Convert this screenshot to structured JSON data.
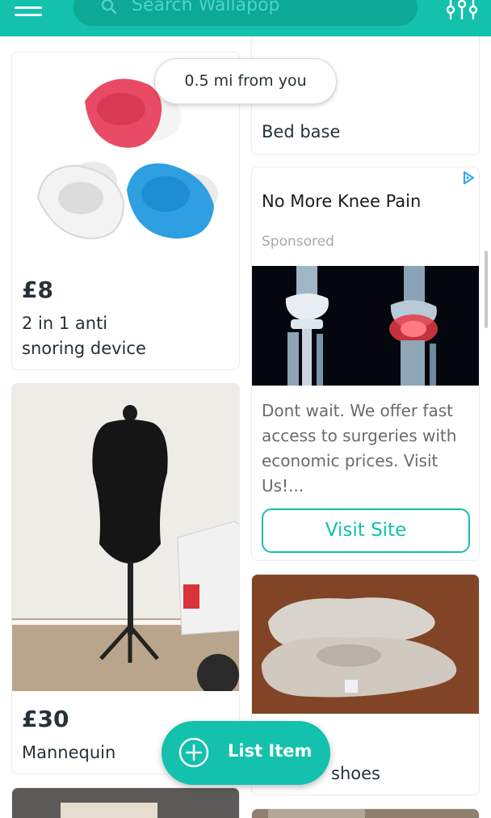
{
  "header": {
    "search_placeholder": "Search Wallapop",
    "menu_icon": "hamburger-menu-icon",
    "search_icon": "search-icon",
    "filter_icon": "sliders-filter-icon"
  },
  "distance_pill": {
    "label": "0.5 mi from you"
  },
  "listings": [
    {
      "price": "£8",
      "title_lines": [
        "2 in 1 anti",
        "snoring device"
      ]
    },
    {
      "price": "£30",
      "title": "Mannequin"
    },
    {
      "title": "Bed base"
    },
    {
      "title": "shoes"
    }
  ],
  "ad": {
    "title": "No More Knee Pain",
    "sponsored_label": "Sponsored",
    "description_lines": [
      "Dont wait. We offer fast",
      "access to surgeries with",
      "economic prices. Visit",
      "Us!..."
    ],
    "cta": "Visit Site",
    "badge_icon": "adchoices-icon"
  },
  "fab": {
    "label": "List Item",
    "icon": "plus-circle-icon"
  },
  "colors": {
    "brand": "#13c1ac",
    "text": "#253238",
    "muted": "#a9a9a9"
  }
}
